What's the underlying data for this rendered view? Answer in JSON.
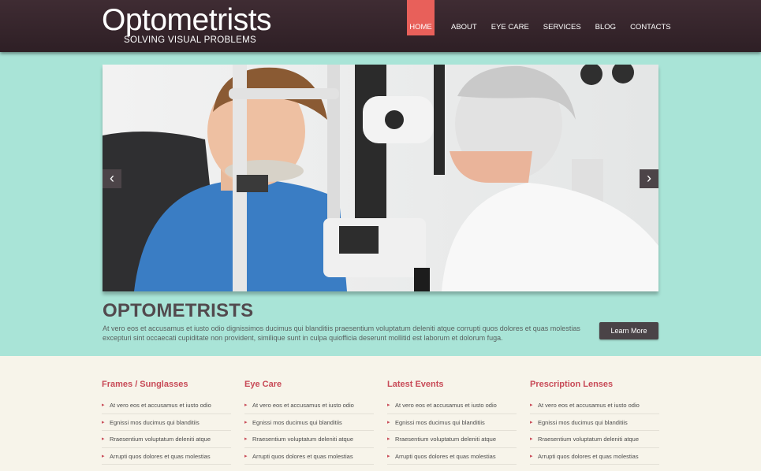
{
  "header": {
    "logo": "Optometrists",
    "tagline": "SOLVING VISUAL PROBLEMS",
    "nav": [
      "HOME",
      "ABOUT",
      "EYE CARE",
      "SERVICES",
      "BLOG",
      "CONTACTS"
    ]
  },
  "slider": {
    "prev": "‹",
    "next": "›"
  },
  "hero": {
    "title": "OPTOMETRISTS",
    "text": "At vero eos et accusamus et iusto odio dignissimos ducimus qui blanditiis praesentium voluptatum deleniti atque corrupti quos dolores et quas molestias excepturi sint occaecati cupiditate non provident, similique sunt in culpa quiofficia deserunt mollitid est laborum et dolorum fuga.",
    "button": "Learn More"
  },
  "columns": [
    {
      "title": "Frames / Sunglasses",
      "items": [
        "At vero eos et accusamus et iusto odio",
        "Egnissi mos ducimus qui blanditiis",
        "Rraesentium voluptatum deleniti atque",
        "Arrupti quos dolores et quas molestias",
        ""
      ]
    },
    {
      "title": "Eye Care",
      "items": [
        "At vero eos et accusamus et iusto odio",
        "Egnissi mos ducimus qui blanditiis",
        "Rraesentium voluptatum deleniti atque",
        "Arrupti quos dolores et quas molestias",
        ""
      ]
    },
    {
      "title": "Latest Events",
      "items": [
        "At vero eos et accusamus et iusto odio",
        "Egnissi mos ducimus qui blanditiis",
        "Rraesentium voluptatum deleniti atque",
        "Arrupti quos dolores et quas molestias",
        ""
      ]
    },
    {
      "title": "Prescription Lenses",
      "items": [
        "At vero eos et accusamus et iusto odio",
        "Egnissi mos ducimus qui blanditiis",
        "Rraesentium voluptatum deleniti atque",
        "Arrupti quos dolores et quas molestias",
        ""
      ]
    }
  ],
  "colors": {
    "accent": "#e8605a",
    "header": "#3a2930",
    "band": "#a9e4d7",
    "heading": "#c84a57"
  }
}
